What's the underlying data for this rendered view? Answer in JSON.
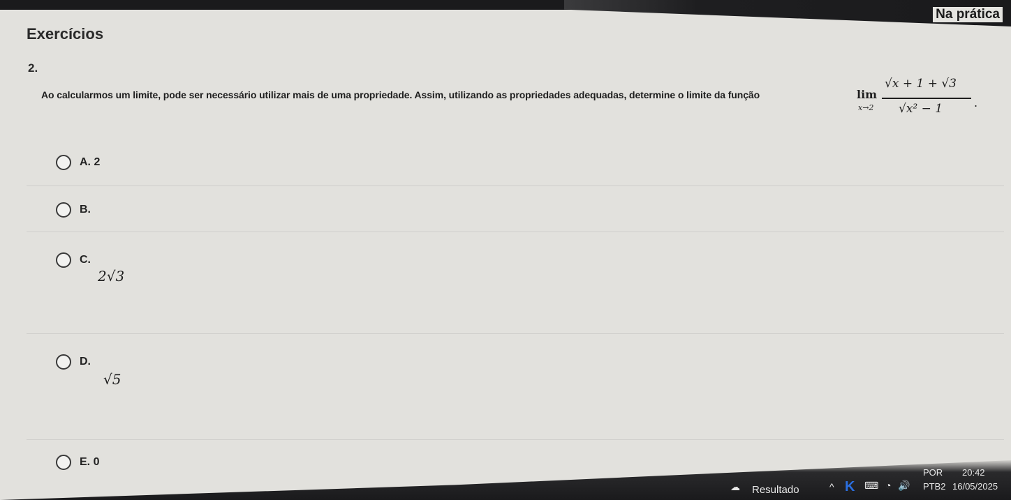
{
  "header": {
    "title": "Na prática"
  },
  "section": {
    "title": "Exercícios"
  },
  "question": {
    "number": "2.",
    "text": "Ao calcularmos um limite, pode ser necessário utilizar mais de uma propriedade. Assim, utilizando as propriedades adequadas, determine o limite da função",
    "formula": {
      "lim": "lim",
      "lim_sub": "x→2",
      "numerator": "√x + 1 + √3",
      "denominator": "√x² − 1",
      "end": "."
    }
  },
  "options": [
    {
      "letter": "A. 2",
      "math": ""
    },
    {
      "letter": "B.",
      "math": ""
    },
    {
      "letter": "C.",
      "math": "2√3"
    },
    {
      "letter": "D.",
      "math": "√5"
    },
    {
      "letter": "E. 0",
      "math": ""
    }
  ],
  "taskbar": {
    "app_label": "Resultado",
    "language": "POR",
    "layout": "PTB2",
    "time": "20:42",
    "date": "16/05/2025",
    "icons": [
      "weather-icon",
      "chevron-up-icon",
      "k-app-icon",
      "keyboard-icon",
      "network-icon",
      "volume-icon"
    ]
  }
}
